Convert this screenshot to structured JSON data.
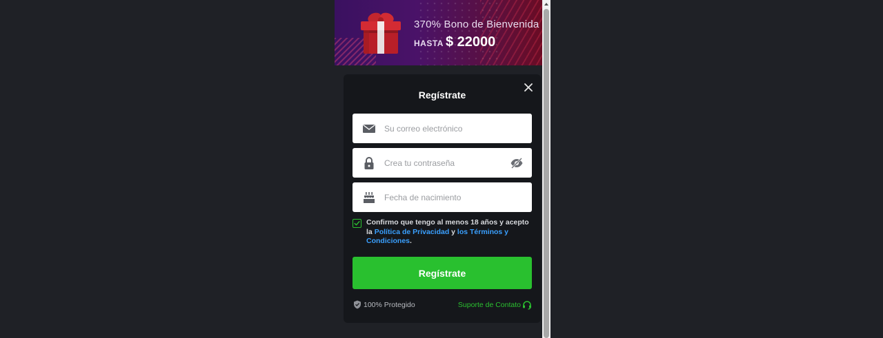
{
  "banner": {
    "title": "370% Bono de Bienvenida",
    "hasta": "HASTA",
    "amount": "$ 22000",
    "gift_icon": "gift-box-icon"
  },
  "modal": {
    "title": "Regístrate",
    "close_icon": "close-icon",
    "email": {
      "placeholder": "Su correo electrónico",
      "value": "",
      "icon": "envelope-icon"
    },
    "password": {
      "placeholder": "Crea tu contraseña",
      "value": "",
      "icon": "lock-icon",
      "toggle_icon": "eye-off-icon"
    },
    "birthdate": {
      "placeholder": "Fecha de nacimiento",
      "value": "",
      "icon": "birthday-cake-icon"
    },
    "consent": {
      "checked": true,
      "text_before": "Confirmo que tengo al menos 18 años y acepto la ",
      "privacy_link": "Política de Privacidad",
      "text_and": " y ",
      "terms_link": "los Términos y Condiciones",
      "text_after": "."
    },
    "submit_label": "Regístrate",
    "protected_label": "100% Protegido",
    "support_label": "Suporte de Contato"
  },
  "colors": {
    "background": "#1f2126",
    "modal_bg": "#15171b",
    "accent_green": "#29c02f",
    "link_blue": "#3aa0ff"
  }
}
